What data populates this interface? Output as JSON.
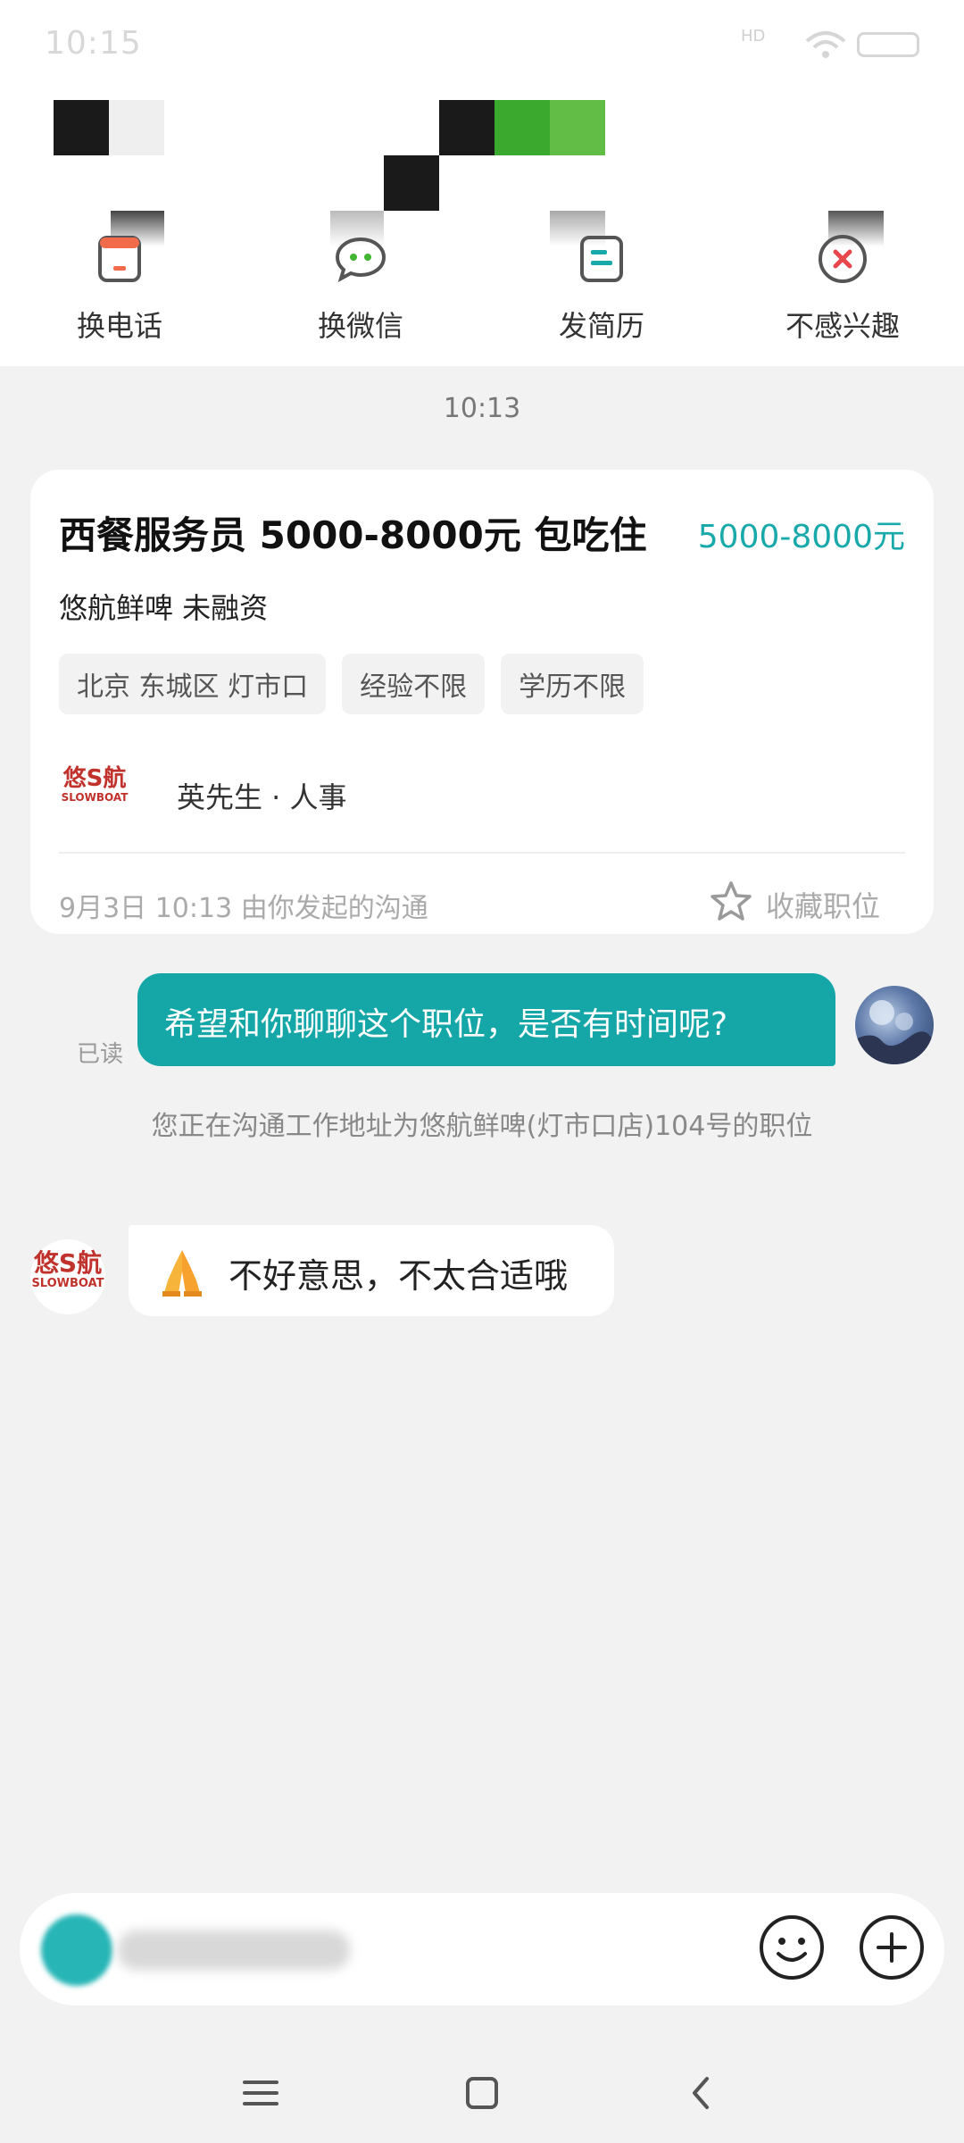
{
  "status_bar": {
    "time": "10:15",
    "network": "HD"
  },
  "nav": [
    {
      "label": "换电话",
      "icon": "phone-card-icon"
    },
    {
      "label": "换微信",
      "icon": "wechat-icon"
    },
    {
      "label": "发简历",
      "icon": "resume-icon"
    },
    {
      "label": "不感兴趣",
      "icon": "not-interested-icon"
    }
  ],
  "chat": {
    "timestamp": "10:13",
    "job_card": {
      "title": "西餐服务员 5000-8000元 包吃住",
      "salary": "5000-8000元",
      "company": "悠航鲜啤 未融资",
      "tags": [
        "北京 东城区 灯市口",
        "经验不限",
        "学历不限"
      ],
      "recruiter": "英先生 · 人事",
      "logo_text": "悠S航",
      "logo_sub": "SLOWBOAT",
      "footer": "9月3日 10:13 由你发起的沟通",
      "favorite_label": "收藏职位"
    },
    "outgoing": {
      "text": "希望和你聊聊这个职位，是否有时间呢?",
      "read_status": "已读"
    },
    "system_note": "您正在沟通工作地址为悠航鲜啤(灯市口店)104号的职位",
    "incoming": {
      "text": "不好意思，不太合适哦",
      "emoji": "folded-hands"
    }
  },
  "colors": {
    "accent": "#15a6a8",
    "salary": "#19a9ab",
    "brand_red": "#c0322b",
    "background": "#f2f2f2"
  }
}
